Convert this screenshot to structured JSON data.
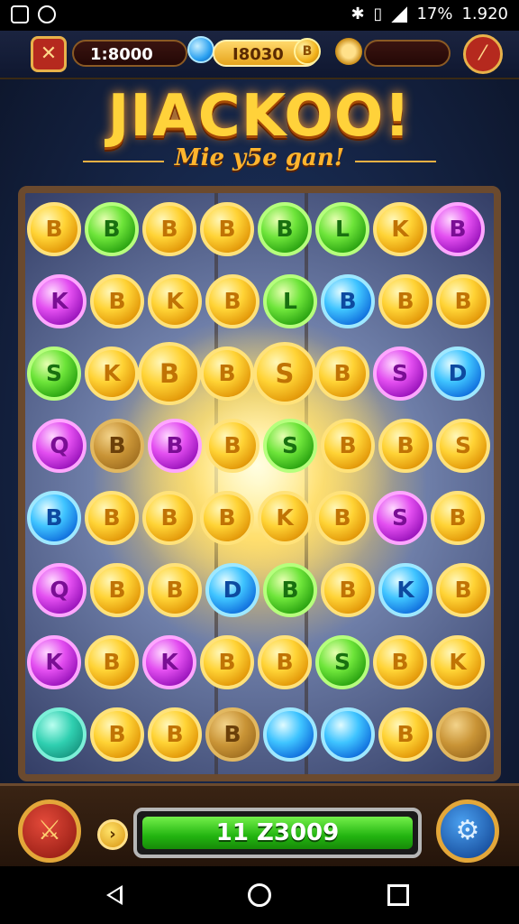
{
  "status_bar": {
    "battery": "17%",
    "time": "1.920"
  },
  "hud": {
    "balance": "1:8000",
    "gems": "I8030",
    "gem_coin_glyph": "B",
    "menu_icon": "sword-icon",
    "tool_icon": "wand-icon"
  },
  "title": "JIACKOO!",
  "subtitle": "Mie y5e gan!",
  "board": {
    "coin_colors": {
      "gold": "#ffd335",
      "green": "#6ee53a",
      "blue": "#3fc4ff",
      "purple": "#e34ef0"
    },
    "coins": [
      {
        "color": "gold",
        "glyph": "B"
      },
      {
        "color": "green",
        "glyph": "B"
      },
      {
        "color": "gold",
        "glyph": "B"
      },
      {
        "color": "gold",
        "glyph": "B"
      },
      {
        "color": "green",
        "glyph": "B"
      },
      {
        "color": "green",
        "glyph": "L"
      },
      {
        "color": "gold",
        "glyph": "K"
      },
      {
        "color": "purple",
        "glyph": "B"
      },
      {
        "color": "purple",
        "glyph": "K"
      },
      {
        "color": "gold",
        "glyph": "B"
      },
      {
        "color": "gold",
        "glyph": "K"
      },
      {
        "color": "gold",
        "glyph": "B"
      },
      {
        "color": "green",
        "glyph": "L"
      },
      {
        "color": "blue",
        "glyph": "B"
      },
      {
        "color": "gold",
        "glyph": "B"
      },
      {
        "color": "gold",
        "glyph": "B"
      },
      {
        "color": "green",
        "glyph": "S"
      },
      {
        "color": "gold",
        "glyph": "K"
      },
      {
        "color": "gold",
        "glyph": "B"
      },
      {
        "color": "gold",
        "glyph": "B"
      },
      {
        "color": "gold",
        "glyph": "S"
      },
      {
        "color": "gold",
        "glyph": "B"
      },
      {
        "color": "purple",
        "glyph": "S"
      },
      {
        "color": "blue",
        "glyph": "D"
      },
      {
        "color": "purple",
        "glyph": "Q"
      },
      {
        "color": "dark",
        "glyph": "B"
      },
      {
        "color": "purple",
        "glyph": "B"
      },
      {
        "color": "gold",
        "glyph": "B"
      },
      {
        "color": "green",
        "glyph": "S"
      },
      {
        "color": "gold",
        "glyph": "B"
      },
      {
        "color": "gold",
        "glyph": "B"
      },
      {
        "color": "gold",
        "glyph": "S"
      },
      {
        "color": "blue",
        "glyph": "B"
      },
      {
        "color": "gold",
        "glyph": "B"
      },
      {
        "color": "gold",
        "glyph": "B"
      },
      {
        "color": "gold",
        "glyph": "B"
      },
      {
        "color": "gold",
        "glyph": "K"
      },
      {
        "color": "gold",
        "glyph": "B"
      },
      {
        "color": "purple",
        "glyph": "S"
      },
      {
        "color": "gold",
        "glyph": "B"
      },
      {
        "color": "purple",
        "glyph": "Q"
      },
      {
        "color": "gold",
        "glyph": "B"
      },
      {
        "color": "gold",
        "glyph": "B"
      },
      {
        "color": "blue",
        "glyph": "D"
      },
      {
        "color": "green",
        "glyph": "B"
      },
      {
        "color": "gold",
        "glyph": "B"
      },
      {
        "color": "blue",
        "glyph": "K"
      },
      {
        "color": "gold",
        "glyph": "B"
      },
      {
        "color": "purple",
        "glyph": "K"
      },
      {
        "color": "gold",
        "glyph": "B"
      },
      {
        "color": "purple",
        "glyph": "K"
      },
      {
        "color": "gold",
        "glyph": "B"
      },
      {
        "color": "gold",
        "glyph": "B"
      },
      {
        "color": "green",
        "glyph": "S"
      },
      {
        "color": "gold",
        "glyph": "B"
      },
      {
        "color": "gold",
        "glyph": "K"
      },
      {
        "color": "teal",
        "glyph": ""
      },
      {
        "color": "gold",
        "glyph": "B"
      },
      {
        "color": "gold",
        "glyph": "B"
      },
      {
        "color": "dark",
        "glyph": "B"
      },
      {
        "color": "blue",
        "glyph": ""
      },
      {
        "color": "blue",
        "glyph": ""
      },
      {
        "color": "gold",
        "glyph": "B"
      },
      {
        "color": "dark",
        "glyph": ""
      }
    ]
  },
  "bottom": {
    "balance": "11 Z3009",
    "left_icon": "sword-icon",
    "small_icon": "arrow-right-icon",
    "right_icon": "gear-icon"
  }
}
